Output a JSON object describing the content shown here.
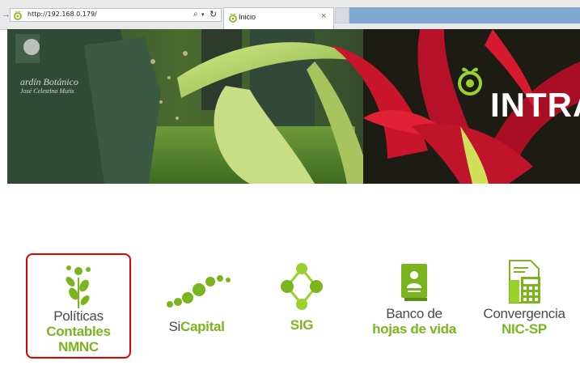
{
  "browser": {
    "address_url": "http://192.168.0.179/",
    "tab_title": "Inicio",
    "tab_close": "×",
    "search_glyph": "⌕",
    "dropdown_glyph": "▾",
    "refresh_glyph": "↻",
    "back_glyph": "→"
  },
  "hero": {
    "logo_text": "INTRA",
    "garden_text_line1": "ardín Botánico",
    "garden_text_line2": "José Celestino Mutis"
  },
  "apps": [
    {
      "line1": "Políticas",
      "line2": "Contables",
      "line3": "NMNC",
      "icon": "plant-icon"
    },
    {
      "line1_grey": "Si",
      "line1_green": "Capital",
      "icon": "sicapital-dots-icon"
    },
    {
      "line1": "SIG",
      "icon": "sig-diamond-icon"
    },
    {
      "line1": "Banco de",
      "line2": "hojas de vida",
      "icon": "resume-book-icon"
    },
    {
      "line1": "Convergencia",
      "line2": "NIC-SP",
      "icon": "calculator-document-icon"
    }
  ],
  "colors": {
    "green": "#7ab51d",
    "highlight_border": "#e20000",
    "grey_text": "#4a4a4a"
  }
}
